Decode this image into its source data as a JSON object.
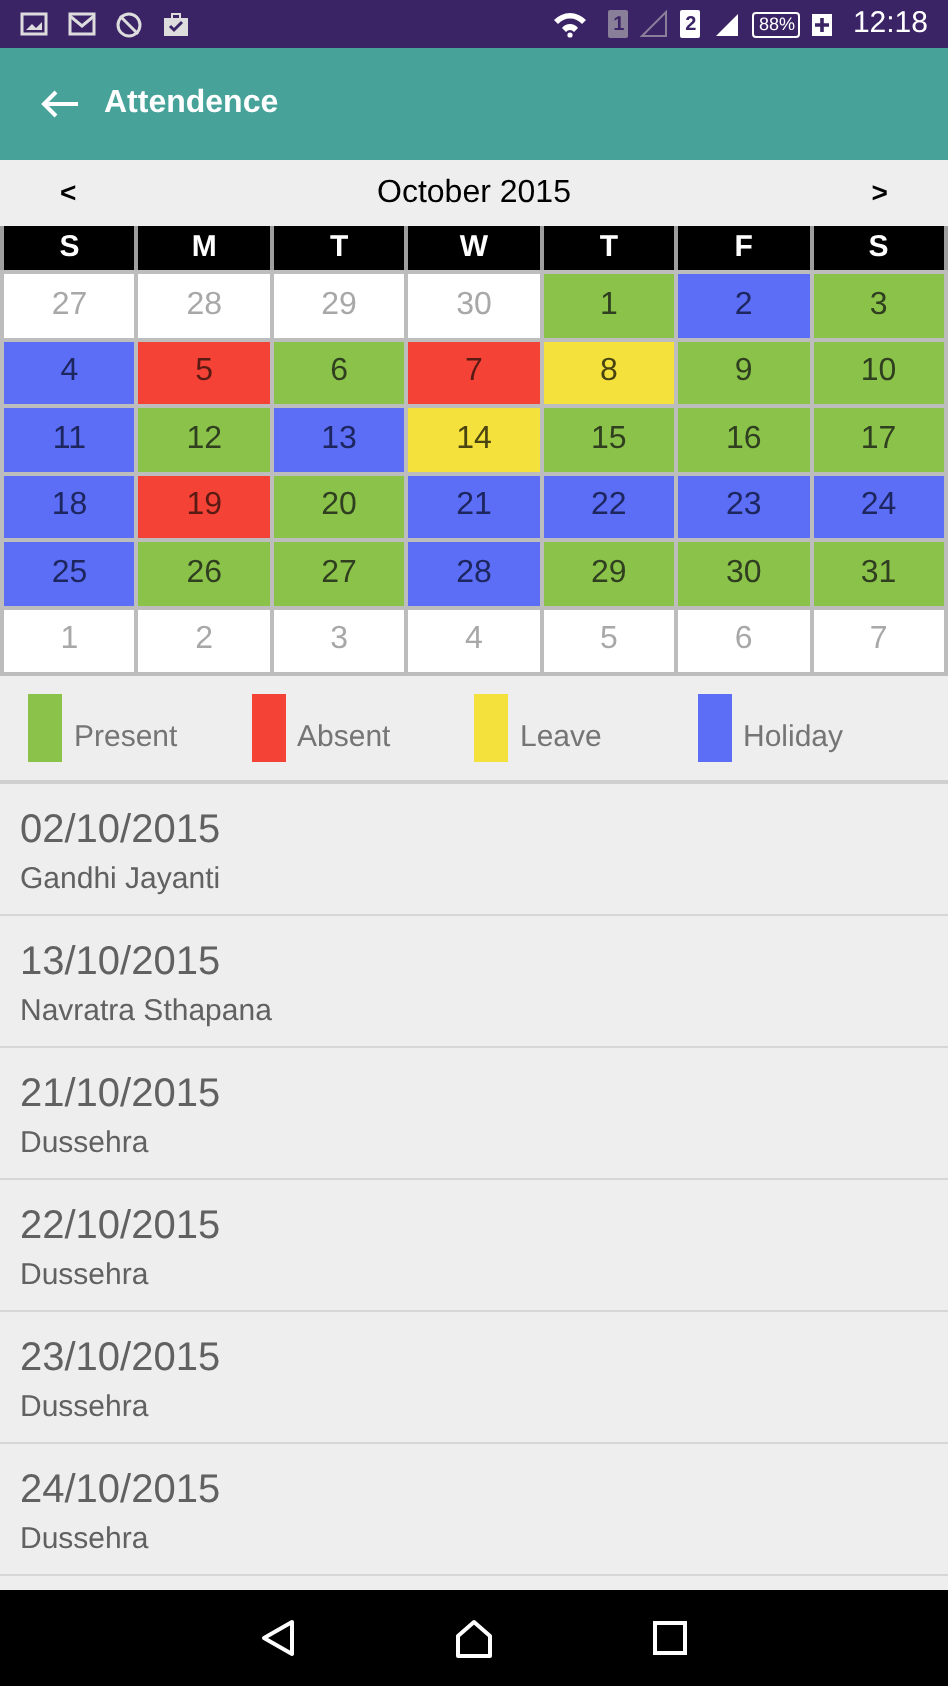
{
  "status_bar": {
    "sim_1": "1",
    "sim_2": "2",
    "battery": "88%",
    "time": "12:18"
  },
  "app_bar": {
    "title": "Attendence"
  },
  "calendar": {
    "prev": "<",
    "month": "October 2015",
    "next": ">",
    "weekdays": [
      "S",
      "M",
      "T",
      "W",
      "T",
      "F",
      "S"
    ],
    "days": [
      {
        "day": "27",
        "kind": "other"
      },
      {
        "day": "28",
        "kind": "other"
      },
      {
        "day": "29",
        "kind": "other"
      },
      {
        "day": "30",
        "kind": "other"
      },
      {
        "day": "1",
        "kind": "present"
      },
      {
        "day": "2",
        "kind": "holiday"
      },
      {
        "day": "3",
        "kind": "present"
      },
      {
        "day": "4",
        "kind": "holiday"
      },
      {
        "day": "5",
        "kind": "absent"
      },
      {
        "day": "6",
        "kind": "present"
      },
      {
        "day": "7",
        "kind": "absent"
      },
      {
        "day": "8",
        "kind": "leave"
      },
      {
        "day": "9",
        "kind": "present"
      },
      {
        "day": "10",
        "kind": "present"
      },
      {
        "day": "11",
        "kind": "holiday"
      },
      {
        "day": "12",
        "kind": "present"
      },
      {
        "day": "13",
        "kind": "holiday"
      },
      {
        "day": "14",
        "kind": "leave"
      },
      {
        "day": "15",
        "kind": "present"
      },
      {
        "day": "16",
        "kind": "present"
      },
      {
        "day": "17",
        "kind": "present"
      },
      {
        "day": "18",
        "kind": "holiday"
      },
      {
        "day": "19",
        "kind": "absent"
      },
      {
        "day": "20",
        "kind": "present"
      },
      {
        "day": "21",
        "kind": "holiday"
      },
      {
        "day": "22",
        "kind": "holiday"
      },
      {
        "day": "23",
        "kind": "holiday"
      },
      {
        "day": "24",
        "kind": "holiday"
      },
      {
        "day": "25",
        "kind": "holiday"
      },
      {
        "day": "26",
        "kind": "present"
      },
      {
        "day": "27",
        "kind": "present"
      },
      {
        "day": "28",
        "kind": "holiday"
      },
      {
        "day": "29",
        "kind": "present"
      },
      {
        "day": "30",
        "kind": "present"
      },
      {
        "day": "31",
        "kind": "present"
      },
      {
        "day": "1",
        "kind": "other"
      },
      {
        "day": "2",
        "kind": "other"
      },
      {
        "day": "3",
        "kind": "other"
      },
      {
        "day": "4",
        "kind": "other"
      },
      {
        "day": "5",
        "kind": "other"
      },
      {
        "day": "6",
        "kind": "other"
      },
      {
        "day": "7",
        "kind": "other"
      }
    ]
  },
  "legend": [
    {
      "label": "Present",
      "color": "#8bc34a"
    },
    {
      "label": "Absent",
      "color": "#f44336"
    },
    {
      "label": "Leave",
      "color": "#f5e13b"
    },
    {
      "label": "Holiday",
      "color": "#5b6ef5"
    }
  ],
  "holidays": [
    {
      "date": "02/10/2015",
      "name": "Gandhi Jayanti"
    },
    {
      "date": "13/10/2015",
      "name": "Navratra Sthapana"
    },
    {
      "date": "21/10/2015",
      "name": "Dussehra"
    },
    {
      "date": "22/10/2015",
      "name": "Dussehra"
    },
    {
      "date": "23/10/2015",
      "name": "Dussehra"
    },
    {
      "date": "24/10/2015",
      "name": "Dussehra"
    }
  ]
}
